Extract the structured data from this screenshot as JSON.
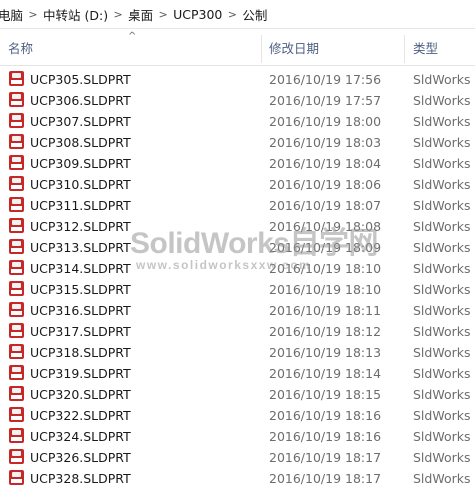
{
  "breadcrumb": [
    "电脑",
    "中转站 (D:)",
    "桌面",
    "UCP300",
    "公制"
  ],
  "breadcrumb_separator": ">",
  "columns": {
    "name": "名称",
    "date": "修改日期",
    "type": "类型"
  },
  "sort_arrow": "^",
  "watermark": {
    "title": "SolidWorks自学网",
    "url": "www.solidworksxxw.com"
  },
  "files": [
    {
      "name": "UCP305.SLDPRT",
      "date": "2016/10/19 17:56",
      "type": "SldWorks Pa"
    },
    {
      "name": "UCP306.SLDPRT",
      "date": "2016/10/19 17:57",
      "type": "SldWorks Pa"
    },
    {
      "name": "UCP307.SLDPRT",
      "date": "2016/10/19 18:00",
      "type": "SldWorks Pa"
    },
    {
      "name": "UCP308.SLDPRT",
      "date": "2016/10/19 18:03",
      "type": "SldWorks Pa"
    },
    {
      "name": "UCP309.SLDPRT",
      "date": "2016/10/19 18:04",
      "type": "SldWorks Pa"
    },
    {
      "name": "UCP310.SLDPRT",
      "date": "2016/10/19 18:06",
      "type": "SldWorks Pa"
    },
    {
      "name": "UCP311.SLDPRT",
      "date": "2016/10/19 18:07",
      "type": "SldWorks Pa"
    },
    {
      "name": "UCP312.SLDPRT",
      "date": "2016/10/19 18:08",
      "type": "SldWorks Pa"
    },
    {
      "name": "UCP313.SLDPRT",
      "date": "2016/10/19 18:09",
      "type": "SldWorks Pa"
    },
    {
      "name": "UCP314.SLDPRT",
      "date": "2016/10/19 18:10",
      "type": "SldWorks Pa"
    },
    {
      "name": "UCP315.SLDPRT",
      "date": "2016/10/19 18:10",
      "type": "SldWorks Pa"
    },
    {
      "name": "UCP316.SLDPRT",
      "date": "2016/10/19 18:11",
      "type": "SldWorks Pa"
    },
    {
      "name": "UCP317.SLDPRT",
      "date": "2016/10/19 18:12",
      "type": "SldWorks Pa"
    },
    {
      "name": "UCP318.SLDPRT",
      "date": "2016/10/19 18:13",
      "type": "SldWorks Pa"
    },
    {
      "name": "UCP319.SLDPRT",
      "date": "2016/10/19 18:14",
      "type": "SldWorks Pa"
    },
    {
      "name": "UCP320.SLDPRT",
      "date": "2016/10/19 18:15",
      "type": "SldWorks Pa"
    },
    {
      "name": "UCP322.SLDPRT",
      "date": "2016/10/19 18:16",
      "type": "SldWorks Pa"
    },
    {
      "name": "UCP324.SLDPRT",
      "date": "2016/10/19 18:16",
      "type": "SldWorks Pa"
    },
    {
      "name": "UCP326.SLDPRT",
      "date": "2016/10/19 18:17",
      "type": "SldWorks Pa"
    },
    {
      "name": "UCP328.SLDPRT",
      "date": "2016/10/19 18:17",
      "type": "SldWorks Pa"
    }
  ],
  "file_icon": "solidworks-part-icon"
}
